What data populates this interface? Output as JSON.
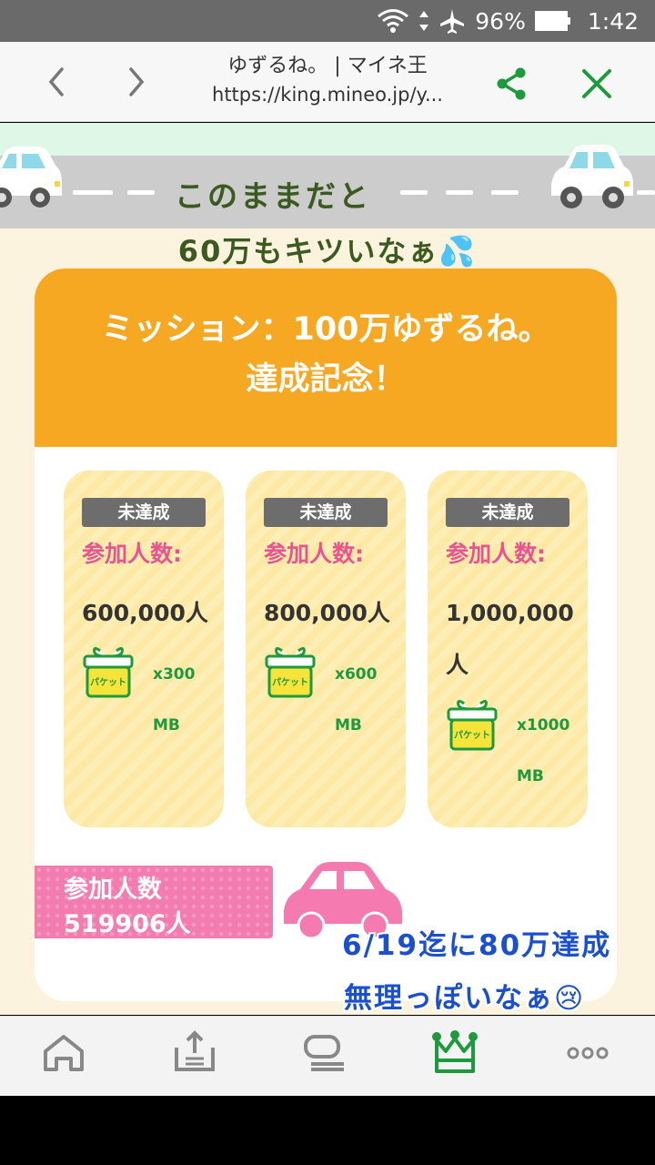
{
  "status_bar": {
    "battery": "96%",
    "time": "1:42"
  },
  "browser": {
    "title": "ゆずるね。 | マイネ王",
    "url": "https://king.mineo.jp/y..."
  },
  "banner": {
    "road_text": "このままだと",
    "sub_text": "60万もキツいなぁ💦"
  },
  "mission": {
    "title_line1": "ミッション：100万ゆずるね。",
    "title_line2": "達成記念！",
    "goals": [
      {
        "status": "未達成",
        "label": "参加人数:",
        "value": "600,000人",
        "reward": "x300 MB"
      },
      {
        "status": "未達成",
        "label": "参加人数:",
        "value": "800,000人",
        "reward": "x600 MB"
      },
      {
        "status": "未達成",
        "label": "参加人数:",
        "value": "1,000,000人",
        "reward": "x1000 MB"
      }
    ],
    "gift_label": "パケット",
    "count_label": "参加人数",
    "count_value": "519906人"
  },
  "overlay": {
    "line1": "6/19迄に80万達成",
    "line2": "無理っぽいなぁ😢"
  },
  "bottom_nav": [
    "home-icon",
    "upload-icon",
    "chat-icon",
    "crown-icon",
    "more-icon"
  ],
  "colors": {
    "accent_orange": "#f6a823",
    "pink": "#e9538f",
    "green": "#1d9a3c",
    "overlay_blue": "#1a4fd0"
  }
}
